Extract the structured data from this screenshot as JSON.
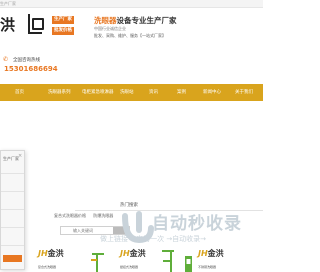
{
  "topbar": {
    "text": "生产厂家"
  },
  "header": {
    "logo_text": "洪",
    "badges": [
      "生产厂家",
      "批发价格"
    ],
    "slogan_highlight": "洗眼器",
    "slogan_rest": "设备专业生产厂家",
    "subline": "中国行业诚信企业",
    "services": "批发、采购、维护、服务【一站式厂家】"
  },
  "hotline": {
    "label": "全国咨询热线",
    "number": "15301686694",
    "icon": "phone-icon"
  },
  "nav": {
    "items": [
      "首页",
      "洗眼器系列",
      "电柜紧急喷淋器",
      "洗眼站",
      "资讯",
      "案例",
      "新闻中心",
      "关于我们"
    ]
  },
  "float_panel": {
    "title": "生产厂家",
    "close": "×"
  },
  "hot_search": {
    "title": "热门搜索",
    "row": "复合式洗眼器价格",
    "row2": "防爆洗眼器",
    "placeholder": "输入关键词"
  },
  "watermark": {
    "main": "自动秒收录",
    "sub": "做上链接 →来访一次 →自动收录→"
  },
  "products": [
    {
      "brand_mark": "JH",
      "brand": "金洪",
      "caption": "复合式洗眼器"
    },
    {
      "brand_mark": "JH",
      "brand": "金洪",
      "caption": "壁挂式洗眼器"
    },
    {
      "brand_mark": "JH",
      "brand": "金洪",
      "caption": "不锈钢洗眼器"
    }
  ],
  "colors": {
    "accent": "#e87722",
    "nav": "#d9a41d",
    "watermark": "#c9d3da",
    "machine_green": "#5fae3a"
  }
}
